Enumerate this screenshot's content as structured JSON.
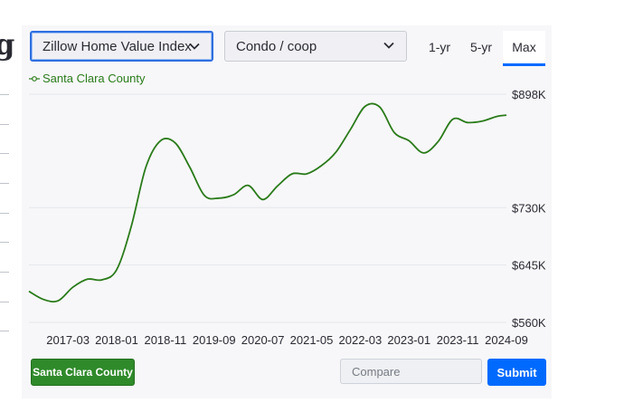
{
  "page": {
    "left_glyph": "g"
  },
  "controls": {
    "metric_select": "Zillow Home Value Index",
    "home_type_select": "Condo / coop",
    "range_tabs": [
      "1-yr",
      "5-yr",
      "Max"
    ],
    "active_range": "Max"
  },
  "legend": {
    "label": "Santa Clara County"
  },
  "footer": {
    "series_button": "Santa Clara County",
    "compare_placeholder": "Compare",
    "submit_label": "Submit"
  },
  "colors": {
    "series": "#2a7b1a",
    "accent": "#006aff",
    "series_button": "#2f8a2a"
  },
  "chart_data": {
    "type": "line",
    "title": "",
    "xlabel": "",
    "ylabel": "",
    "y_ticks": [
      "$898K",
      "$730K",
      "$645K",
      "$560K"
    ],
    "y_tick_values": [
      898,
      730,
      645,
      560
    ],
    "x_ticks": [
      "2017-03",
      "2018-01",
      "2018-11",
      "2019-09",
      "2020-07",
      "2021-05",
      "2022-03",
      "2023-01",
      "2023-11",
      "2024-09"
    ],
    "ylim": [
      560,
      898
    ],
    "xlim": [
      "2016-07",
      "2024-09"
    ],
    "grid": true,
    "series": [
      {
        "name": "Santa Clara County",
        "x": [
          "2016-07",
          "2016-10",
          "2017-01",
          "2017-04",
          "2017-07",
          "2017-10",
          "2018-01",
          "2018-04",
          "2018-07",
          "2018-10",
          "2019-01",
          "2019-04",
          "2019-07",
          "2019-10",
          "2020-01",
          "2020-04",
          "2020-07",
          "2020-10",
          "2021-01",
          "2021-04",
          "2021-07",
          "2021-10",
          "2022-01",
          "2022-04",
          "2022-07",
          "2022-10",
          "2023-01",
          "2023-04",
          "2023-07",
          "2023-10",
          "2024-01",
          "2024-04",
          "2024-07",
          "2024-09"
        ],
        "values": [
          606,
          594,
          592,
          612,
          624,
          623,
          638,
          702,
          790,
          829,
          826,
          790,
          748,
          744,
          749,
          763,
          742,
          762,
          780,
          780,
          792,
          812,
          846,
          880,
          879,
          841,
          829,
          811,
          828,
          861,
          856,
          858,
          865,
          867
        ]
      }
    ]
  }
}
